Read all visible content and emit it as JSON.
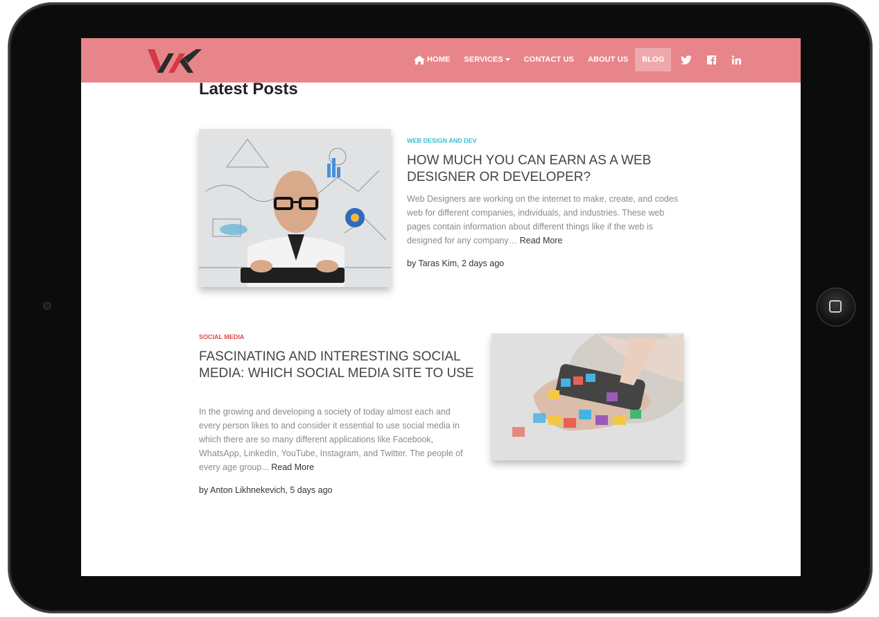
{
  "nav": {
    "items": [
      {
        "label": "HOME",
        "icon": "home-icon"
      },
      {
        "label": "SERVICES",
        "dropdown": true
      },
      {
        "label": "CONTACT US"
      },
      {
        "label": "ABOUT US"
      },
      {
        "label": "BLOG",
        "active": true
      }
    ],
    "social": [
      "twitter-icon",
      "facebook-icon",
      "linkedin-icon"
    ],
    "bg_color": "#e8858a"
  },
  "page": {
    "heading": "Latest Posts"
  },
  "posts": [
    {
      "category": "WEB DESIGN AND DEV",
      "category_color": "#3bbfcf",
      "title": "HOW MUCH YOU CAN EARN AS A WEB DESIGNER OR DEVELOPER?",
      "excerpt": "Web Designers are working on the internet to make, create, and codes web for different companies, individuals, and industries. These web pages contain information about different things like if the web is designed for any company…",
      "read_more": "Read More",
      "byline": "by Taras Kim, 2 days ago"
    },
    {
      "category": "SOCIAL MEDIA",
      "category_color": "#e04848",
      "title": "FASCINATING AND INTERESTING SOCIAL MEDIA: WHICH SOCIAL MEDIA SITE TO USE",
      "excerpt": "In the growing and developing a society of today almost each and every person likes to and consider it essential to use social media in which there are so many different applications like Facebook, WhatsApp, LinkedIn, YouTube, Instagram, and Twitter. The people of every age group...",
      "read_more": "Read More",
      "byline": "by Anton Likhnekevich, 5 days ago"
    }
  ]
}
